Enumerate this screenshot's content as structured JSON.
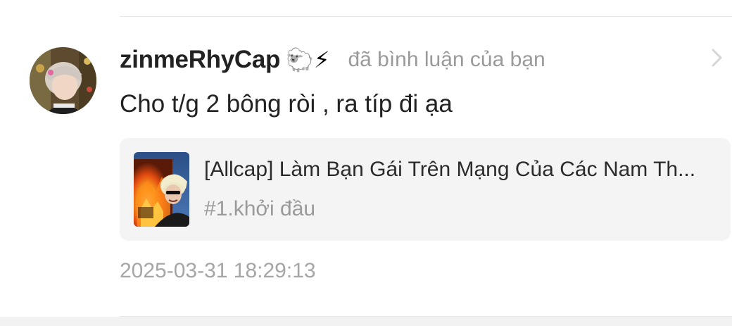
{
  "notification": {
    "username": "zinmeRhyCap",
    "badges": [
      {
        "emoji": "🐑",
        "icon": "sheep-icon"
      },
      {
        "emoji": "⚡",
        "icon": "lightning-icon"
      }
    ],
    "action_text": "đã bình luận của bạn",
    "comment": "Cho t/g 2 bông ròi , ra típ đi ạa",
    "story": {
      "title": "[Allcap] Làm Bạn Gái Trên Mạng Của Các Nam Th...",
      "chapter": "#1.khởi đầu"
    },
    "timestamp": "2025-03-31 18:29:13",
    "icons": {
      "chevron": "chevron-right-icon",
      "avatar": "user-avatar"
    }
  },
  "colors": {
    "username": "#222222",
    "secondary_text": "#9a9a9a",
    "card_background": "#f4f4f4",
    "divider": "#e6e6e6"
  }
}
